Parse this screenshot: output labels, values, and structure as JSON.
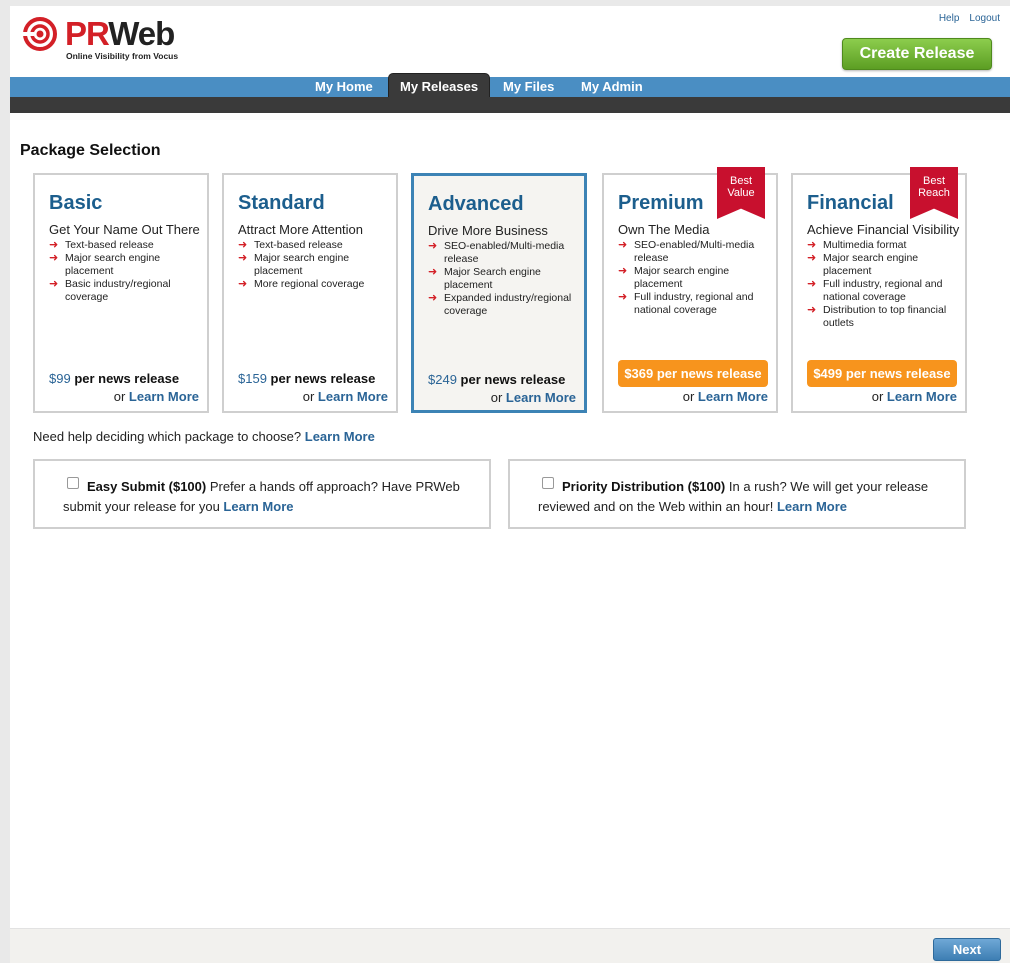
{
  "header": {
    "logo_brand_1": "PR",
    "logo_brand_2": "Web",
    "logo_tagline": "Online Visibility from Vocus",
    "help_link": "Help",
    "logout_link": "Logout",
    "create_button": "Create Release"
  },
  "nav": {
    "tabs": [
      {
        "label": "My Home",
        "active": false
      },
      {
        "label": "My Releases",
        "active": true
      },
      {
        "label": "My Files",
        "active": false
      },
      {
        "label": "My Admin",
        "active": false
      }
    ]
  },
  "main": {
    "section_title": "Package Selection",
    "packages": [
      {
        "name": "Basic",
        "tagline": "Get Your Name Out There",
        "features": [
          "Text-based release",
          "Major search engine placement",
          "Basic industry/regional coverage"
        ],
        "price": "$99",
        "price_suffix": " per news release",
        "learn_prefix": "or ",
        "learn_link": "Learn More"
      },
      {
        "name": "Standard",
        "tagline": "Attract More Attention",
        "features": [
          "Text-based release",
          "Major search engine placement",
          "More regional coverage"
        ],
        "price": "$159",
        "price_suffix": " per news release",
        "learn_prefix": "or ",
        "learn_link": "Learn More"
      },
      {
        "name": "Advanced",
        "tagline": "Drive More Business",
        "features": [
          "SEO-enabled/Multi-media release",
          "Major Search engine placement",
          "Expanded industry/regional coverage"
        ],
        "price": "$249",
        "price_suffix": " per news release",
        "learn_prefix": "or ",
        "learn_link": "Learn More"
      },
      {
        "name": "Premium",
        "tagline": "Own The Media",
        "features": [
          "SEO-enabled/Multi-media release",
          "Major search engine placement",
          "Full industry, regional and national coverage"
        ],
        "price_pill": "$369 per news release",
        "ribbon": "Best Value",
        "learn_prefix": "or ",
        "learn_link": "Learn More"
      },
      {
        "name": "Financial",
        "tagline": "Achieve Financial Visibility",
        "features": [
          "Multimedia format",
          "Major search engine placement",
          "Full industry, regional and national coverage",
          "Distribution to top financial outlets"
        ],
        "price_pill": "$499 per news release",
        "ribbon": "Best Reach",
        "learn_prefix": "or ",
        "learn_link": "Learn More"
      }
    ],
    "help_text": "Need help deciding which package to choose? ",
    "help_link": "Learn More",
    "addons": [
      {
        "title": "Easy Submit ($100)",
        "description": " Prefer a hands off approach? Have PRWeb submit your release for you ",
        "link": "Learn More"
      },
      {
        "title": "Priority Distribution ($100)",
        "description": " In a rush? We will get your release reviewed and on the Web within an hour! ",
        "link": "Learn More"
      }
    ]
  },
  "footer": {
    "next_button": "Next"
  },
  "colors": {
    "brand_red": "#d32027",
    "nav_blue": "#4a8ec3",
    "link_blue": "#2a6496",
    "create_green": "#6cb52d",
    "price_orange": "#f7941d",
    "selected_border": "#3c83b5"
  }
}
